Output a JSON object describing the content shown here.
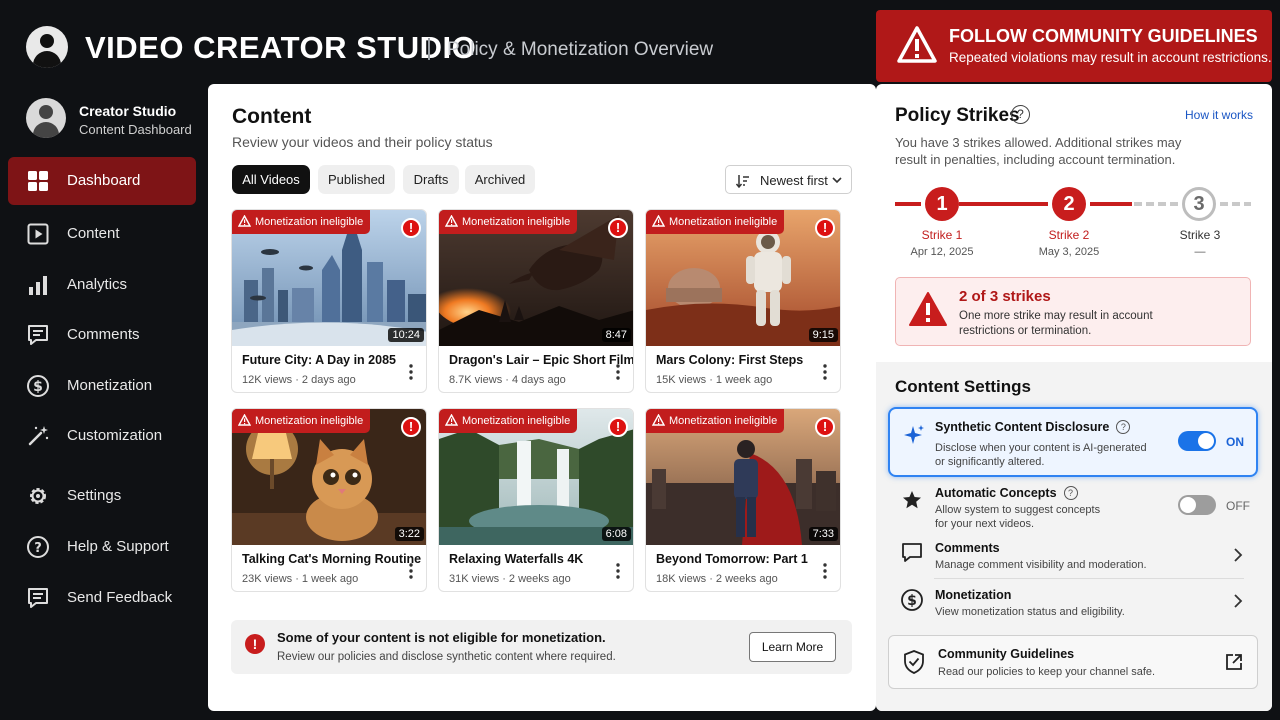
{
  "header": {
    "app_title": "VIDEO CREATOR STUDIO",
    "subtitle": "Policy & Monetization Overview",
    "alert_title": "FOLLOW COMMUNITY GUIDELINES",
    "alert_text": "Repeated violations may result in account restrictions."
  },
  "sidebar": {
    "user_name": "Creator Studio",
    "user_sub": "Content Dashboard",
    "items": [
      {
        "label": "Dashboard",
        "icon": "dashboard-icon"
      },
      {
        "label": "Content",
        "icon": "play-square-icon"
      },
      {
        "label": "Analytics",
        "icon": "bar-chart-icon"
      },
      {
        "label": "Comments",
        "icon": "comment-icon"
      },
      {
        "label": "Monetization",
        "icon": "dollar-icon"
      },
      {
        "label": "Customization",
        "icon": "magic-wand-icon"
      },
      {
        "label": "Settings",
        "icon": "gear-icon"
      },
      {
        "label": "Help & Support",
        "icon": "help-icon"
      },
      {
        "label": "Send Feedback",
        "icon": "feedback-icon"
      }
    ]
  },
  "main": {
    "title": "Content",
    "subtitle": "Review your videos and their policy status",
    "chips": [
      "All Videos",
      "Published",
      "Drafts",
      "Archived"
    ],
    "sort_label": "Newest first",
    "badge_label": "Monetization ineligible",
    "cards": [
      {
        "title": "Future City: A Day in 2085",
        "views": "12K views",
        "age": "2 days ago",
        "duration": "10:24"
      },
      {
        "title": "Dragon's Lair – Epic Short Film",
        "views": "8.7K views",
        "age": "4 days ago",
        "duration": "8:47"
      },
      {
        "title": "Mars Colony: First Steps",
        "views": "15K views",
        "age": "1 week ago",
        "duration": "9:15"
      },
      {
        "title": "Talking Cat's Morning Routine",
        "views": "23K views",
        "age": "1 week ago",
        "duration": "3:22"
      },
      {
        "title": "Relaxing Waterfalls 4K",
        "views": "31K views",
        "age": "2 weeks ago",
        "duration": "6:08"
      },
      {
        "title": "Beyond Tomorrow: Part 1",
        "views": "18K views",
        "age": "2 weeks ago",
        "duration": "7:33"
      }
    ],
    "notice": {
      "title": "Some of your content is not eligible for monetization.",
      "text": "Review our policies and disclose synthetic content where required.",
      "button": "Learn More"
    }
  },
  "strikes": {
    "title": "Policy Strikes",
    "how_link": "How it works",
    "description": "You have 3 strikes allowed. Additional strikes may result in penalties, including account termination.",
    "items": [
      {
        "number": "1",
        "label": "Strike 1",
        "date": "Apr 12, 2025",
        "active": true
      },
      {
        "number": "2",
        "label": "Strike 2",
        "date": "May 3, 2025",
        "active": true
      },
      {
        "number": "3",
        "label": "Strike 3",
        "date": "—",
        "active": false
      }
    ],
    "warning_title": "2 of 3 strikes",
    "warning_text": "One more strike may result in account restrictions or termination."
  },
  "settings": {
    "title": "Content Settings",
    "synthetic": {
      "title": "Synthetic Content Disclosure",
      "text": "Disclose when your content is AI-generated or significantly altered.",
      "state": "ON"
    },
    "auto": {
      "title": "Automatic Concepts",
      "text": "Allow system to suggest concepts for your next videos.",
      "state": "OFF"
    },
    "comments": {
      "title": "Comments",
      "text": "Manage comment visibility and moderation."
    },
    "monetization": {
      "title": "Monetization",
      "text": "View monetization status and eligibility."
    },
    "guidelines": {
      "title": "Community Guidelines",
      "text": "Read our policies to keep your channel safe."
    }
  },
  "colors": {
    "accent_red": "#b01818",
    "active_nav": "#7e1416",
    "toggle_on": "#1a73e8"
  }
}
